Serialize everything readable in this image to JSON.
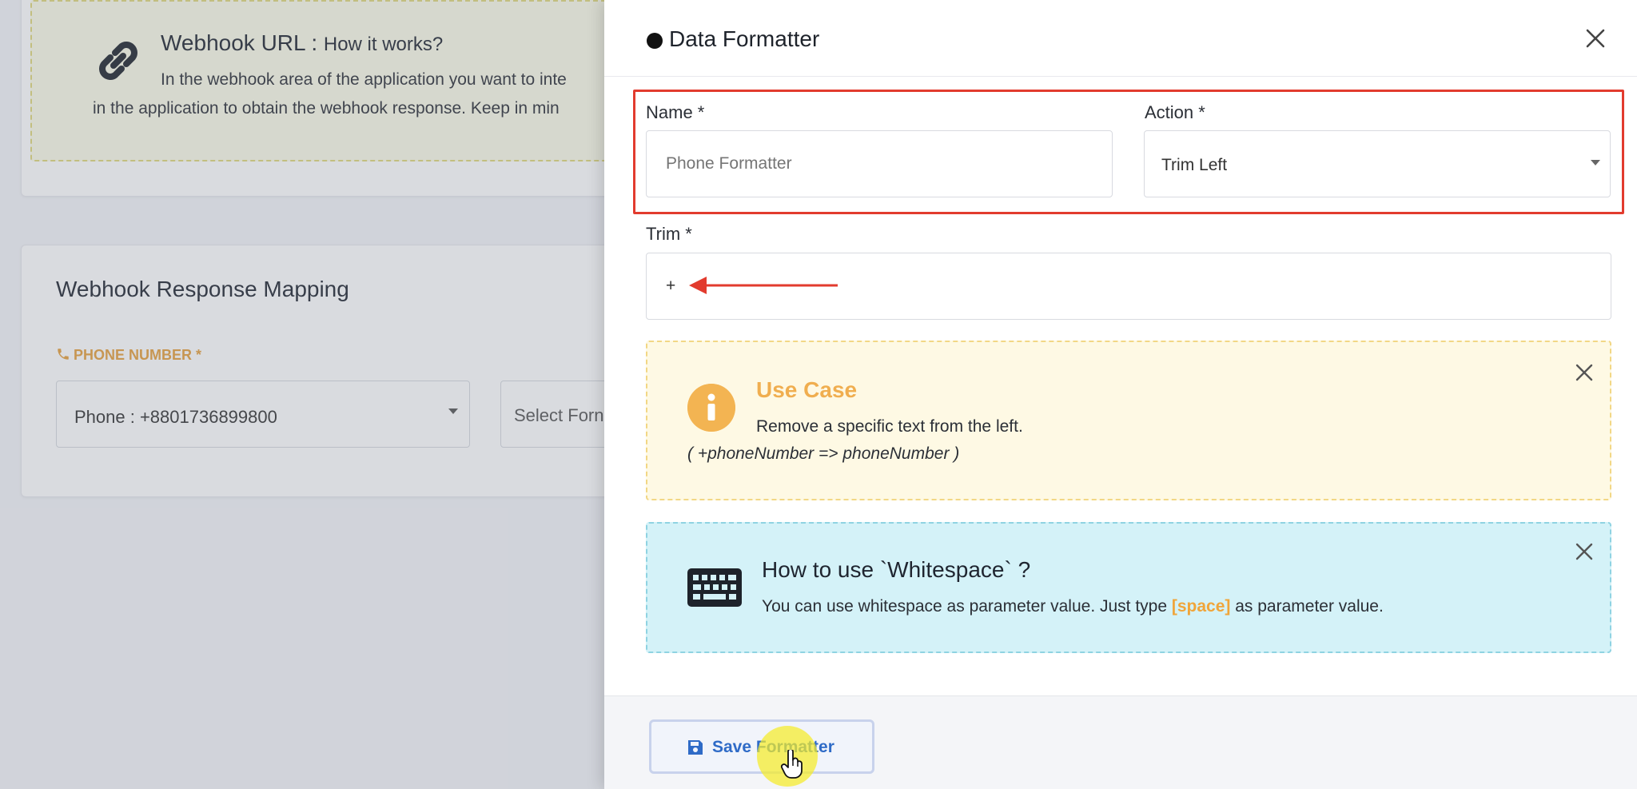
{
  "background": {
    "webhook": {
      "title": "Webhook URL : ",
      "title_sub": "How it works?",
      "desc_line1": "In the webhook area of the application you want to inte",
      "desc_line2": "in the application to obtain the webhook response. Keep in min"
    },
    "mapping": {
      "title": "Webhook Response Mapping",
      "phone_label": "PHONE NUMBER *",
      "phone_select_value": "Phone : +8801736899800",
      "format_select_placeholder": "Select Forn"
    }
  },
  "modal": {
    "title": "Data Formatter",
    "name_label": "Name *",
    "name_placeholder": "Phone Formatter",
    "action_label": "Action *",
    "action_value": "Trim Left",
    "trim_label": "Trim *",
    "trim_value": "+",
    "usecase": {
      "title": "Use Case",
      "description": "Remove a specific text from the left.",
      "example": "( +phoneNumber => phoneNumber )"
    },
    "whitespace": {
      "title": "How to use `Whitespace` ?",
      "desc_before": "You can use whitespace as parameter value. Just type ",
      "desc_highlight": "[space]",
      "desc_after": " as parameter value."
    },
    "save_label": "Save Formatter"
  },
  "colors": {
    "highlight_border": "#e23b2e",
    "usecase_accent": "#f0ae4f",
    "whitespace_bg": "#d4f2f8",
    "save_text": "#2f6bc7"
  },
  "icons": {
    "webhook": "link-icon",
    "phone": "phone-icon",
    "info": "info-icon",
    "keyboard": "keyboard-icon",
    "close": "close-icon",
    "save": "floppy-disk-icon",
    "cursor": "hand-cursor-icon"
  }
}
